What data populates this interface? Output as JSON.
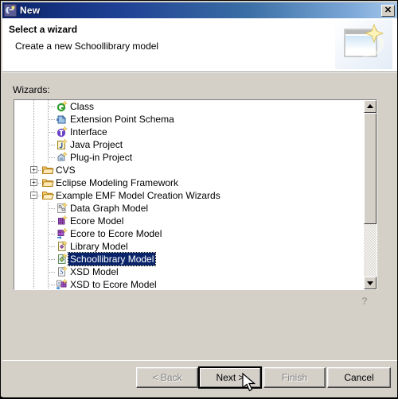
{
  "window": {
    "title": "New",
    "title_icon": "eclipse-new-icon",
    "close_label": "✕"
  },
  "header": {
    "title": "Select a wizard",
    "description": "Create a new Schoollibrary model",
    "banner_icon": "wizard-banner-image"
  },
  "main": {
    "wizards_label": "Wizards:",
    "help_label": "?",
    "selected_item": "Schoollibrary Model",
    "scrollbar": {
      "up_arrow": "▲",
      "down_arrow": "▼",
      "thumb_top_pct": 0,
      "thumb_height_pct": 68
    },
    "tree": [
      {
        "label": "Class",
        "indent": 1,
        "icon": "class-icon",
        "expander": "none",
        "selected": false
      },
      {
        "label": "Extension Point Schema",
        "indent": 1,
        "icon": "extension-schema-icon",
        "expander": "none",
        "selected": false
      },
      {
        "label": "Interface",
        "indent": 1,
        "icon": "interface-icon",
        "expander": "none",
        "selected": false
      },
      {
        "label": "Java Project",
        "indent": 1,
        "icon": "java-project-icon",
        "expander": "none",
        "selected": false
      },
      {
        "label": "Plug-in Project",
        "indent": 1,
        "icon": "plugin-project-icon",
        "expander": "none",
        "selected": false
      },
      {
        "label": "CVS",
        "indent": 0,
        "icon": "folder-icon",
        "expander": "collapsed",
        "selected": false
      },
      {
        "label": "Eclipse Modeling Framework",
        "indent": 0,
        "icon": "folder-icon",
        "expander": "collapsed",
        "selected": false
      },
      {
        "label": "Example EMF Model Creation Wizards",
        "indent": 0,
        "icon": "folder-open-icon",
        "expander": "expanded",
        "selected": false
      },
      {
        "label": "Data Graph Model",
        "indent": 1,
        "icon": "data-graph-model-icon",
        "expander": "none",
        "selected": false
      },
      {
        "label": "Ecore Model",
        "indent": 1,
        "icon": "ecore-model-icon",
        "expander": "none",
        "selected": false
      },
      {
        "label": "Ecore to Ecore Model",
        "indent": 1,
        "icon": "ecore-to-ecore-icon",
        "expander": "none",
        "selected": false
      },
      {
        "label": "Library Model",
        "indent": 1,
        "icon": "library-model-icon",
        "expander": "none",
        "selected": false
      },
      {
        "label": "Schoollibrary Model",
        "indent": 1,
        "icon": "schoollibrary-model-icon",
        "expander": "none",
        "selected": true
      },
      {
        "label": "XSD Model",
        "indent": 1,
        "icon": "xsd-model-icon",
        "expander": "none",
        "selected": false
      },
      {
        "label": "XSD to Ecore Model",
        "indent": 1,
        "icon": "xsd-to-ecore-icon",
        "expander": "none",
        "selected": false
      }
    ]
  },
  "footer": {
    "buttons": [
      {
        "name": "back-button",
        "label": "< Back",
        "disabled": true,
        "default": false
      },
      {
        "name": "next-button",
        "label": "Next >",
        "disabled": false,
        "default": true
      },
      {
        "name": "finish-button",
        "label": "Finish",
        "disabled": true,
        "default": false
      },
      {
        "name": "cancel-button",
        "label": "Cancel",
        "disabled": false,
        "default": false
      }
    ]
  },
  "colors": {
    "title_bar_start": "#0a246a",
    "title_bar_end": "#a6c8ea",
    "dialog_face": "#d4d0c8",
    "selection": "#0a246a",
    "list_background": "#ffffff"
  }
}
